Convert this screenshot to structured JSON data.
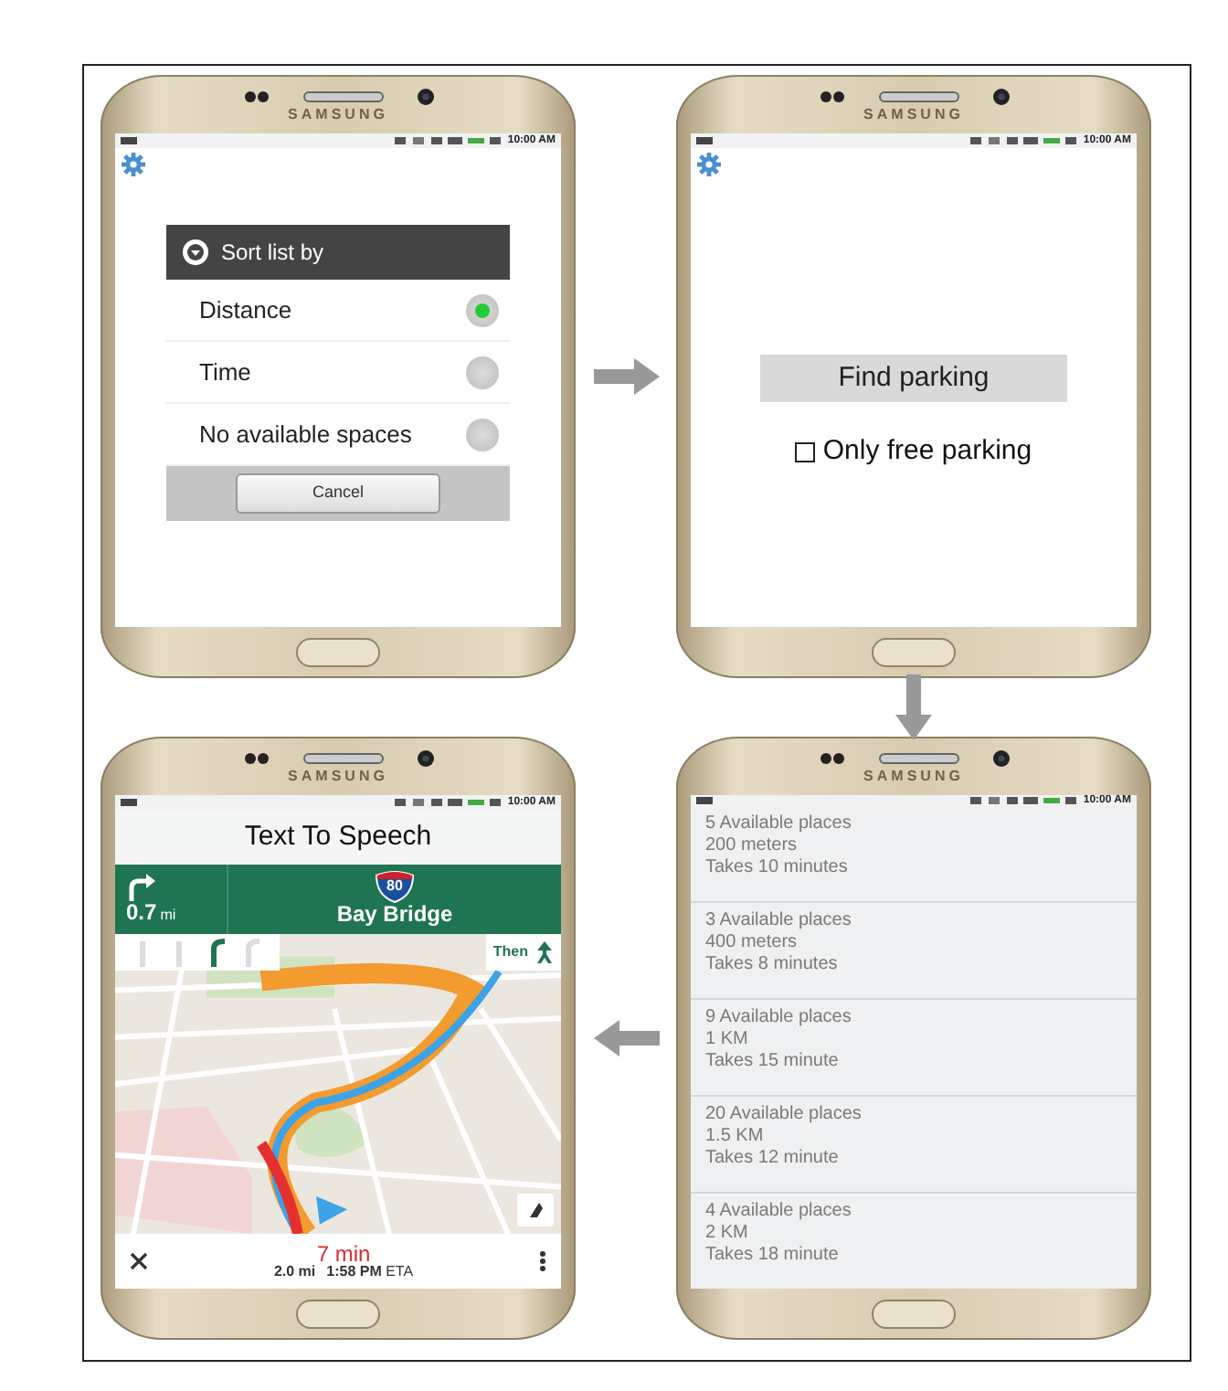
{
  "phones": [
    {
      "brand": "SAMSUNG",
      "status_time": "10:00 AM",
      "screen": {
        "kind": "sort_dialog",
        "title": "Sort list by",
        "options": [
          {
            "label": "Distance",
            "selected": true
          },
          {
            "label": "Time",
            "selected": false
          },
          {
            "label": "No available spaces",
            "selected": false
          }
        ],
        "cancel": "Cancel"
      }
    },
    {
      "brand": "SAMSUNG",
      "status_time": "10:00 AM",
      "screen": {
        "kind": "search",
        "button": "Find parking",
        "checkbox": {
          "label": "Only free parking",
          "checked": false
        }
      }
    },
    {
      "brand": "SAMSUNG",
      "status_time": "10:00 AM",
      "screen": {
        "kind": "navigation",
        "header": "Text To Speech",
        "turn_distance": "0.7",
        "turn_unit": "mi",
        "shield": "80",
        "road": "Bay Bridge",
        "then": "Then",
        "duration": "7 min",
        "trip_distance": "2.0 mi",
        "arrival": "1:58 PM",
        "arrival_suffix": "ETA"
      }
    },
    {
      "brand": "SAMSUNG",
      "status_time": "10:00 AM",
      "screen": {
        "kind": "results",
        "results": [
          {
            "places": "5 Available places",
            "distance": "200 meters",
            "duration": "Takes 10 minutes"
          },
          {
            "places": "3 Available places",
            "distance": "400 meters",
            "duration": "Takes 8 minutes"
          },
          {
            "places": "9 Available places",
            "distance": "1 KM",
            "duration": "Takes 15 minute"
          },
          {
            "places": "20 Available places",
            "distance": "1.5 KM",
            "duration": "Takes 12 minute"
          },
          {
            "places": "4 Available places",
            "distance": "2 KM",
            "duration": "Takes 18 minute"
          }
        ]
      }
    }
  ]
}
